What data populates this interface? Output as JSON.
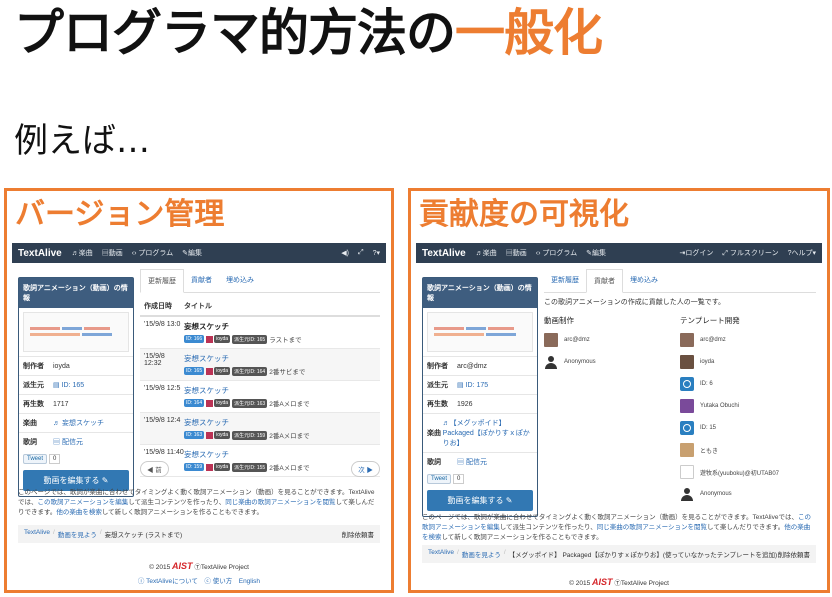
{
  "slide": {
    "title_main": "プログラマ的方法の",
    "title_highlight": "一般化",
    "subtitle": "例えば…"
  },
  "colors": {
    "accent": "#ed7d31",
    "navbar": "#2f3f52",
    "card_header": "#3e5d7f",
    "link": "#2a6bb3",
    "button": "#3278b3"
  },
  "left_panel": {
    "title": "バージョン管理",
    "navbar": {
      "brand": "TextAlive",
      "items": [
        "♬楽曲",
        "▤動画",
        "‹› プログラム",
        "✎編集"
      ],
      "right_items": [
        "◀)",
        "⤢",
        "?▾"
      ]
    },
    "card": {
      "header": "歌詞アニメーション（動画）の情報",
      "rows": [
        {
          "k": "制作者",
          "v": "ioyda"
        },
        {
          "k": "派生元",
          "v": "▤ ID: 165"
        },
        {
          "k": "再生数",
          "v": "1717"
        },
        {
          "k": "楽曲",
          "v": "♬ 妄想スケッチ"
        },
        {
          "k": "歌詞",
          "v": "▤ 配信元"
        }
      ],
      "tweet": "Tweet",
      "tweet_count": "0",
      "edit_button": "動画を編集する ✎"
    },
    "tabs": [
      "更新履歴",
      "貢献者",
      "埋め込み"
    ],
    "table": {
      "col1": "作成日時",
      "col2": "タイトル",
      "rows": [
        {
          "date": "'15/9/8 13:0",
          "title": "妄想スケッチ",
          "badge1": "ID: 166",
          "user": "ioyda",
          "badge2": "派生元ID: 165",
          "note": "ラストまで"
        },
        {
          "date": "'15/9/8 12:32",
          "title": "妄想スケッチ",
          "badge1": "ID: 165",
          "user": "ioyda",
          "badge2": "派生元ID: 164",
          "note": "2番サビまで"
        },
        {
          "date": "'15/9/8 12:5",
          "title": "妄想スケッチ",
          "badge1": "ID: 164",
          "user": "ioyda",
          "badge2": "派生元ID: 163",
          "note": "2番Aメロまで"
        },
        {
          "date": "'15/9/8 12:4",
          "title": "妄想スケッチ",
          "badge1": "ID: 163",
          "user": "ioyda",
          "badge2": "派生元ID: 159",
          "note": "2番Aメロまで"
        },
        {
          "date": "'15/9/8 11:40",
          "title": "妄想スケッチ",
          "badge1": "ID: 159",
          "user": "ioyda",
          "badge2": "派生元ID: 155",
          "note": "2番Aメロまで"
        }
      ]
    },
    "pager": {
      "prev": "◀ 前",
      "next": "次 ▶"
    },
    "desc_a": "このページでは、歌詞が楽曲に合わせてタイミングよく動く歌詞アニメーション（動画）を見ることができます。TextAliveでは、",
    "desc_link1": "この歌詞アニメーションを編集",
    "desc_b": "して派生コンテンツを作ったり、",
    "desc_link2": "同じ楽曲の歌詞アニメーションを閲覧",
    "desc_c": "して楽しんだりできます。",
    "desc_link3": "他の楽曲を検索",
    "desc_d": "して新しく歌詞アニメーションを作ることもできます。",
    "breadcrumb": {
      "items": [
        "TextAlive",
        "動画を見よう",
        "妄想スケッチ (ラストまで)"
      ],
      "right": "削除依頼書"
    },
    "footer": {
      "copyright": "© 2015",
      "aist": "AIST",
      "project": "ⓉTextAlive Project",
      "links": "ⓘ TextAliveについて　ⓒ 使い方　English"
    }
  },
  "right_panel": {
    "title": "貢献度の可視化",
    "navbar": {
      "brand": "TextAlive",
      "items": [
        "♬楽曲",
        "▤動画",
        "‹› プログラム",
        "✎編集"
      ],
      "right_items": [
        "⇥ログイン",
        "⤢ フルスクリーン",
        "?ヘルプ▾"
      ]
    },
    "card": {
      "header": "歌詞アニメーション（動画）の情報",
      "rows": [
        {
          "k": "制作者",
          "v": "arc@dmz"
        },
        {
          "k": "派生元",
          "v": "▤ ID: 175"
        },
        {
          "k": "再生数",
          "v": "1926"
        },
        {
          "k": "楽曲",
          "v": "♬【メグッポイド】 Packaged【ぽかりすｘぽかりお】"
        },
        {
          "k": "歌詞",
          "v": "▤ 配信元"
        }
      ],
      "tweet": "Tweet",
      "tweet_count": "0",
      "edit_button": "動画を編集する ✎"
    },
    "tabs": [
      "更新履歴",
      "貢献者",
      "埋め込み"
    ],
    "intro": "この歌詞アニメーションの作成に貢献した人の一覧です。",
    "col_left": {
      "heading": "動画制作",
      "users": [
        "arc@dmz",
        "Anonymous"
      ]
    },
    "col_right": {
      "heading": "テンプレート開発",
      "users": [
        "arc@dmz",
        "ioyda",
        "ID: 6",
        "Yutaka Obuchi",
        "ID: 15",
        "ともき",
        "遊牧系(yuuboku)@初UTAB07",
        "Anonymous"
      ]
    },
    "desc_a": "このページでは、歌詞が楽曲に合わせてタイミングよく動く歌詞アニメーション（動画）を見ることができます。TextAliveでは、",
    "desc_link1": "この歌詞アニメーションを編集",
    "desc_b": "して派生コンテンツを作ったり、",
    "desc_link2": "同じ楽曲の歌詞アニメーションを閲覧",
    "desc_c": "して楽しんだりできます。",
    "desc_link3": "他の楽曲を検索",
    "desc_d": "して新しく歌詞アニメーションを作ることもできます。",
    "breadcrumb": {
      "items": [
        "TextAlive",
        "動画を見よう",
        "【メグッポイド】 Packaged【ぽかりすｘぽかりお】(使っていなかったテンプレートを追加)"
      ],
      "right": "削除依頼書"
    },
    "footer": {
      "copyright": "© 2015",
      "aist": "AIST",
      "project": "ⓉTextAlive Project"
    }
  }
}
